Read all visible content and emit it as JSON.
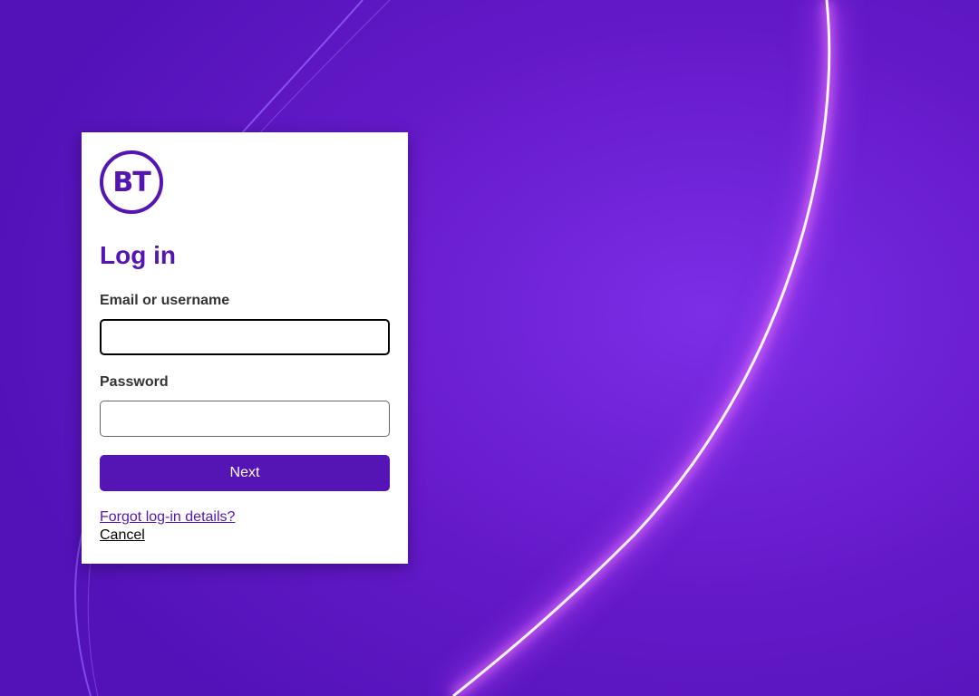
{
  "brand": {
    "logo_text": "BT",
    "color": "#5514b4"
  },
  "background": {
    "description_colors": [
      "#5514b4",
      "#7a2fe0",
      "#e8a6ff"
    ]
  },
  "form": {
    "title": "Log in",
    "email_label": "Email or username",
    "email_value": "",
    "password_label": "Password",
    "password_value": "",
    "next_label": "Next",
    "forgot_link": "Forgot log-in details?",
    "cancel_link": "Cancel"
  }
}
